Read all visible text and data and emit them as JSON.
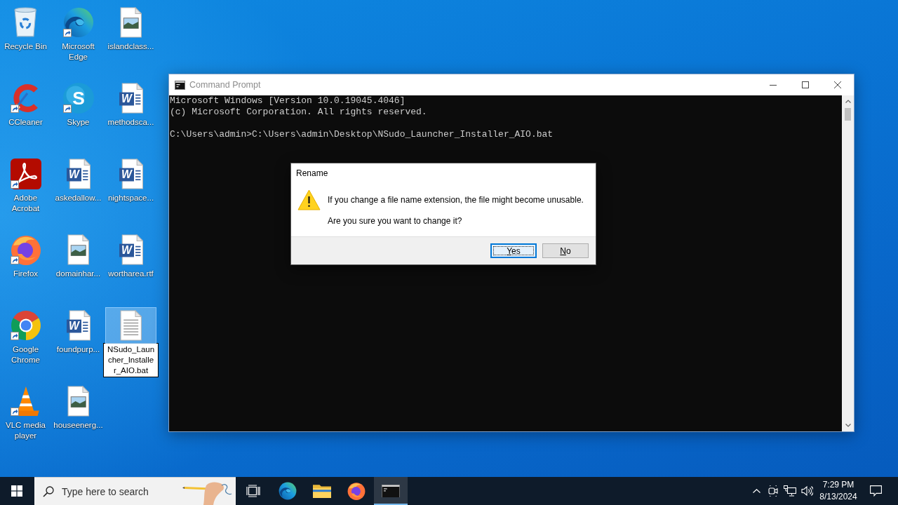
{
  "desktop": {
    "icons": [
      {
        "label": "Recycle Bin",
        "kind": "recycle-bin",
        "shortcut": false,
        "selected": false,
        "renaming": false
      },
      {
        "label": "CCleaner",
        "kind": "ccleaner",
        "shortcut": true,
        "selected": false,
        "renaming": false
      },
      {
        "label": "Adobe Acrobat",
        "kind": "acrobat",
        "shortcut": true,
        "selected": false,
        "renaming": false
      },
      {
        "label": "Firefox",
        "kind": "firefox",
        "shortcut": true,
        "selected": false,
        "renaming": false
      },
      {
        "label": "Google Chrome",
        "kind": "chrome",
        "shortcut": true,
        "selected": false,
        "renaming": false
      },
      {
        "label": "VLC media player",
        "kind": "vlc",
        "shortcut": true,
        "selected": false,
        "renaming": false
      },
      {
        "label": "Microsoft Edge",
        "kind": "edge",
        "shortcut": true,
        "selected": false,
        "renaming": false
      },
      {
        "label": "Skype",
        "kind": "skype",
        "glyph": "S",
        "shortcut": true,
        "selected": false,
        "renaming": false
      },
      {
        "label": "askedallow...",
        "kind": "word",
        "glyph": "W",
        "shortcut": false,
        "selected": false,
        "renaming": false
      },
      {
        "label": "domainhar...",
        "kind": "image",
        "shortcut": false,
        "selected": false,
        "renaming": false
      },
      {
        "label": "foundpurp...",
        "kind": "word",
        "glyph": "W",
        "shortcut": false,
        "selected": false,
        "renaming": false
      },
      {
        "label": "houseenerg...",
        "kind": "image",
        "shortcut": false,
        "selected": false,
        "renaming": false
      },
      {
        "label": "islandclass...",
        "kind": "image",
        "shortcut": false,
        "selected": false,
        "renaming": false
      },
      {
        "label": "methodsca...",
        "kind": "word",
        "glyph": "W",
        "shortcut": false,
        "selected": false,
        "renaming": false
      },
      {
        "label": "nightspace...",
        "kind": "word",
        "glyph": "W",
        "shortcut": false,
        "selected": false,
        "renaming": false
      },
      {
        "label": "wortharea.rtf",
        "kind": "word",
        "glyph": "W",
        "shortcut": false,
        "selected": false,
        "renaming": false
      },
      {
        "label": "NSudo_Launcher_Installer_AIO.bat",
        "kind": "text",
        "shortcut": false,
        "selected": true,
        "renaming": true
      }
    ]
  },
  "window": {
    "title": "Command Prompt",
    "focused": false,
    "console": {
      "output": [
        "Microsoft Windows [Version 10.0.19045.4046]",
        "(c) Microsoft Corporation. All rights reserved."
      ],
      "command_line": "C:\\Users\\admin>C:\\Users\\admin\\Desktop\\NSudo_Launcher_Installer_AIO.bat"
    }
  },
  "dialog": {
    "title": "Rename",
    "message": "If you change a file name extension, the file might become unusable.",
    "question": "Are you sure you want to change it?",
    "buttons": [
      {
        "label": "Yes",
        "selected": true
      },
      {
        "label": "No",
        "selected": false
      }
    ]
  },
  "taskbar": {
    "search": {
      "placeholder": "Type here to search"
    },
    "apps": [
      {
        "kind": "edge",
        "active": false
      },
      {
        "kind": "file-explorer",
        "active": false
      },
      {
        "kind": "firefox",
        "active": false
      },
      {
        "kind": "command-prompt",
        "active": true
      }
    ],
    "clock": {
      "time": "7:29 PM",
      "date": "8/13/2024"
    }
  }
}
